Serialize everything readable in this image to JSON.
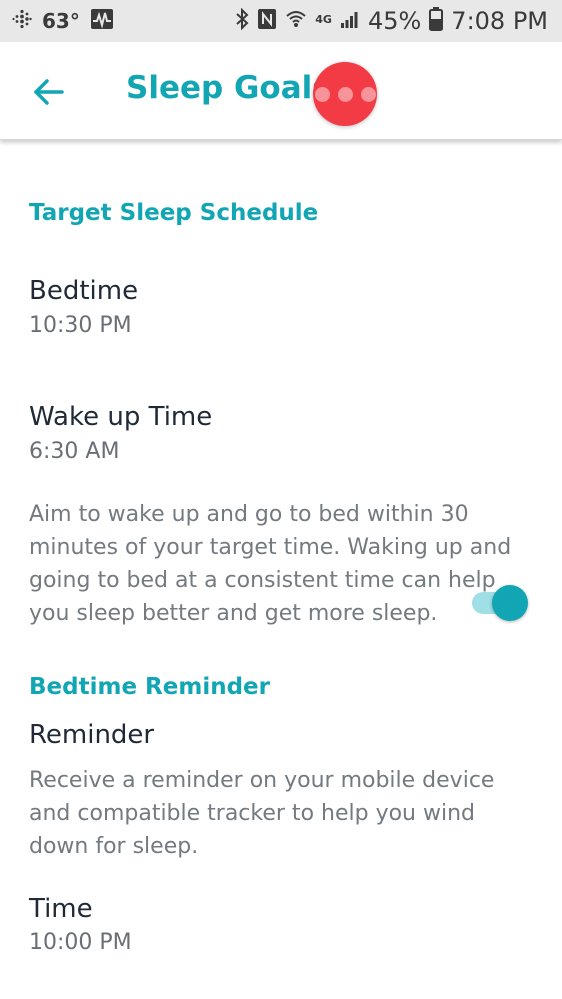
{
  "status_bar": {
    "temperature": "63°",
    "battery_percent": "45%",
    "time": "7:08 PM",
    "network_label": "4G"
  },
  "header": {
    "title": "Sleep Goals",
    "back_icon": "arrow-left-icon",
    "more_icon": "more-horizontal-icon"
  },
  "target_schedule": {
    "header": "Target Sleep Schedule",
    "bedtime": {
      "label": "Bedtime",
      "value": "10:30 PM"
    },
    "wake_up": {
      "label": "Wake up Time",
      "value": "6:30 AM"
    },
    "description": "Aim to wake up and go to bed within 30 minutes of your target time. Waking up and going to bed at a consistent time can help you sleep better and get more sleep."
  },
  "bedtime_reminder": {
    "header": "Bedtime Reminder",
    "reminder": {
      "label": "Reminder",
      "enabled": true
    },
    "description": "Receive a reminder on your mobile device and compatible tracker to help you wind down for sleep.",
    "time": {
      "label": "Time",
      "value": "10:00 PM"
    }
  },
  "colors": {
    "accent": "#12a6b4",
    "fab": "#f23b45",
    "toggle_track": "#9fdfe5",
    "text_primary": "#1f2a36",
    "text_secondary": "#737a80",
    "status_bar_bg": "#e8e8e8"
  }
}
